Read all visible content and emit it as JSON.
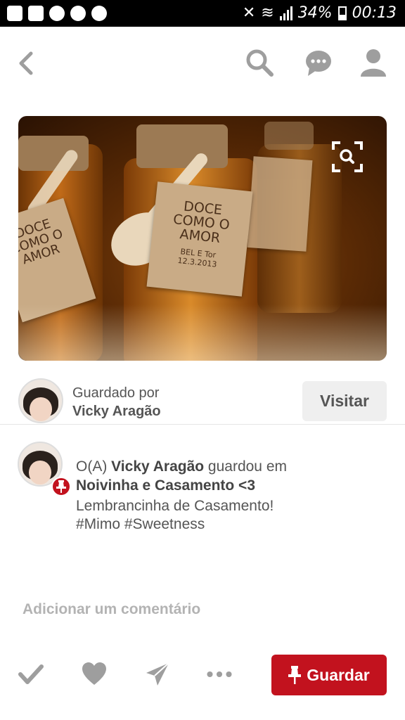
{
  "status_bar": {
    "battery": "34%",
    "time": "00:13"
  },
  "saved_by": {
    "label": "Guardado por",
    "name": "Vicky Aragão"
  },
  "visit_button": "Visitar",
  "pin_info": {
    "prefix": "O(A)",
    "user": "Vicky Aragão",
    "action": "guardou em",
    "board": "Noivinha e Casamento <3",
    "description": "Lembrancinha de Casamento!",
    "tags": "#Mimo #Sweetness"
  },
  "image_tags": {
    "main_line1": "DOCE",
    "main_line2": "COMO O",
    "main_line3": "AMOR",
    "main_small": "BEL E Tor",
    "main_date": "12.3.2013",
    "left_line1": "DOCE",
    "left_line2": "COMO O",
    "left_line3": "AMOR"
  },
  "comment_placeholder": "Adicionar um comentário",
  "save_button": "Guardar",
  "colors": {
    "brand_red": "#c2121e",
    "icon_gray": "#9e9e9e"
  },
  "icons": [
    "back-icon",
    "search-icon",
    "chat-icon",
    "profile-icon",
    "visual-search-icon",
    "check-icon",
    "heart-icon",
    "send-icon",
    "more-icon",
    "pin-icon"
  ]
}
